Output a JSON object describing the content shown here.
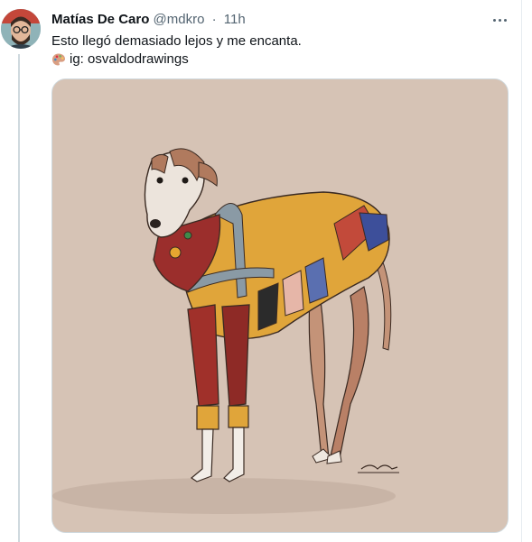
{
  "tweet": {
    "author_name": "Matías De Caro",
    "handle": "@mdkro",
    "separator": "·",
    "time": "11h",
    "text_line1": "Esto llegó demasiado lejos y me encanta.",
    "text_line2": "ig: osvaldodrawings"
  },
  "icons": {
    "more": "more-dots-icon",
    "palette": "artist-palette-icon"
  },
  "colors": {
    "text": "#0f1419",
    "secondary": "#536471",
    "image_background": "#d6c3b5"
  }
}
